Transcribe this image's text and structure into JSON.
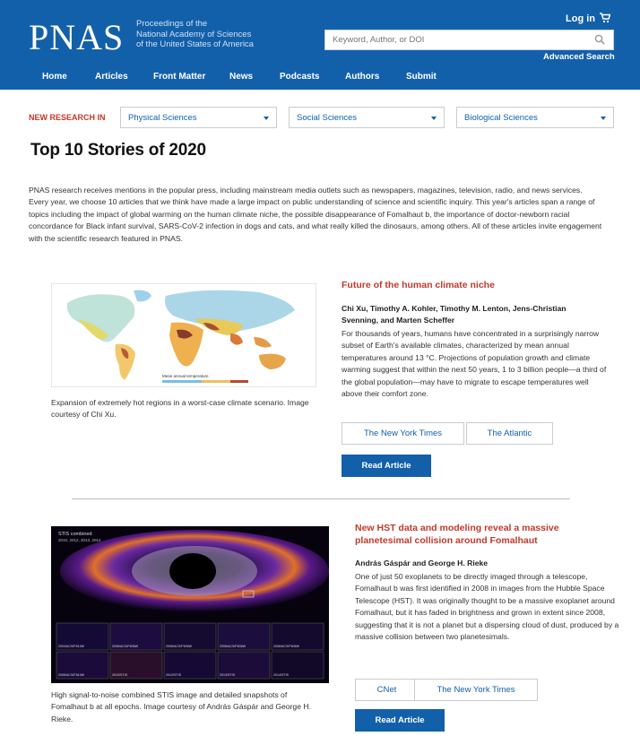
{
  "header": {
    "logo": "PNAS",
    "tagline": [
      "Proceedings of the",
      "National Academy of Sciences",
      "of the United States of America"
    ],
    "login": "Log in",
    "search_placeholder": "Keyword, Author, or DOI",
    "advanced_search": "Advanced Search",
    "nav": [
      "Home",
      "Articles",
      "Front Matter",
      "News",
      "Podcasts",
      "Authors",
      "Submit"
    ],
    "colors": {
      "brand": "#1360aa",
      "accent": "#c0392b"
    }
  },
  "research": {
    "label": "NEW RESEARCH IN",
    "selects": [
      "Physical Sciences",
      "Social Sciences",
      "Biological Sciences"
    ]
  },
  "page": {
    "title": "Top 10 Stories of 2020",
    "intro": "PNAS research receives mentions in the popular press, including mainstream media outlets such as newspapers, magazines, television, radio, and news services. Every year, we choose 10 articles that we think have made a large impact on public understanding of science and scientific inquiry. This year's articles span a range of topics including the impact of global warming on the human climate niche, the possible disappearance of Fomalhaut b, the importance of doctor-newborn racial concordance for Black infant survival, SARS-CoV-2 infection in dogs and cats, and what really killed the dinosaurs, among others. All of these articles invite engagement with the scientific research featured in PNAS."
  },
  "stories": [
    {
      "title": "Future of the human climate niche",
      "authors": "Chi Xu, Timothy A. Kohler, Timothy M. Lenton, Jens-Christian Svenning, and Marten Scheffer",
      "abstract": "For thousands of years, humans have concentrated in a surprisingly narrow subset of Earth's available climates, characterized by mean annual temperatures around 13 °C. Projections of population growth and climate warming suggest that within the next 50 years, 1 to 3 billion people—a third of the global population—may have to migrate to escape temperatures well above their comfort zone.",
      "caption": "Expansion of extremely hot regions in a worst-case climate scenario. Image courtesy of Chi Xu.",
      "map_legend": "Mean annual temperature",
      "media": [
        "The New York Times",
        "The Atlantic"
      ],
      "read": "Read Article"
    },
    {
      "title": "New HST data and modeling reveal a massive planetesimal collision around Fomalhaut",
      "authors": "András Gáspár and George H. Rieke",
      "abstract": "One of just 50 exoplanets to be directly imaged through a telescope, Fomalhaut b was first identified in 2008 in images from the Hubble Space Telescope (HST). It was originally thought to be a massive exoplanet around Fomalhaut, but it has faded in brightness and grown in extent since 2008, suggesting that it is not a planet but a dispersing cloud of dust, produced by a massive collision between two planetesimals.",
      "caption": "High signal-to-noise combined STIS image and detailed snapshots of Fomalhaut b at all epochs. Image courtesy of András Gáspár and George H. Rieke.",
      "image_label": "STIS combined",
      "image_sublabel": "2010, 2012, 2013, 2014",
      "thumbs": [
        "2004/ACS/F814W",
        "2006/ACS/F606W",
        "2006/ACS/F606W",
        "2006/ACS/F606W",
        "2006/ACS/F606W",
        "2006/ACS/F814W",
        "2010/STIS",
        "2012/STIS",
        "2013/STIS",
        "2014/STIS"
      ],
      "media": [
        "CNet",
        "The New York Times"
      ],
      "read": "Read Article"
    }
  ]
}
